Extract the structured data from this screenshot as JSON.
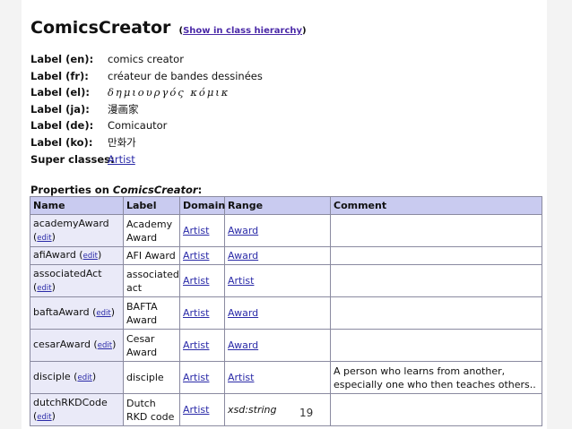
{
  "title": "ComicsCreator",
  "hierarchy": {
    "open": "(",
    "link": "Show in class hierarchy",
    "close": ")"
  },
  "labels": [
    {
      "key": "Label (en):",
      "value": "comics creator"
    },
    {
      "key": "Label (fr):",
      "value": "créateur de bandes dessinées"
    },
    {
      "key": "Label (el):",
      "value": "δημιουργός κόμικ"
    },
    {
      "key": "Label (ja):",
      "value": "漫画家"
    },
    {
      "key": "Label (de):",
      "value": "Comicautor"
    },
    {
      "key": "Label (ko):",
      "value": "만화가"
    }
  ],
  "super": {
    "key": "Super classes:",
    "value": "Artist"
  },
  "props_heading": {
    "prefix": "Properties on ",
    "cls": "ComicsCreator",
    "suffix": ":"
  },
  "columns": [
    "Name",
    "Label",
    "Domain",
    "Range",
    "Comment"
  ],
  "rows": [
    {
      "name": "academyAward",
      "edit": "edit",
      "label": "Academy Award",
      "domain": "Artist",
      "range": "Award",
      "comment": ""
    },
    {
      "name": "afiAward",
      "edit": "edit",
      "label": "AFI Award",
      "domain": "Artist",
      "range": "Award",
      "comment": ""
    },
    {
      "name": "associatedAct",
      "edit": "edit",
      "label": "associated act",
      "domain": "Artist",
      "range": "Artist",
      "comment": ""
    },
    {
      "name": "baftaAward",
      "edit": "edit",
      "label": "BAFTA Award",
      "domain": "Artist",
      "range": "Award",
      "comment": ""
    },
    {
      "name": "cesarAward",
      "edit": "edit",
      "label": "Cesar Award",
      "domain": "Artist",
      "range": "Award",
      "comment": ""
    },
    {
      "name": "disciple",
      "edit": "edit",
      "label": "disciple",
      "domain": "Artist",
      "range": "Artist",
      "comment": "A person who learns from another, especially one who then teaches others.."
    },
    {
      "name": "dutchRKDCode",
      "edit": "edit",
      "label": "Dutch RKD code",
      "domain": "Artist",
      "range": "xsd:string",
      "comment": ""
    }
  ],
  "page_number": "19"
}
